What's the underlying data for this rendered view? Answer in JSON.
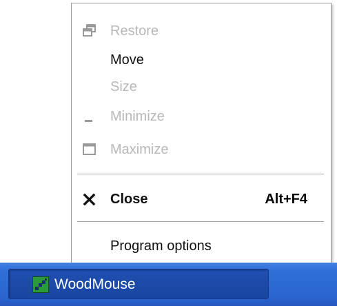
{
  "menu": {
    "items": [
      {
        "label": "Restore",
        "enabled": false,
        "icon": "restore-icon"
      },
      {
        "label": "Move",
        "enabled": true,
        "icon": ""
      },
      {
        "label": "Size",
        "enabled": false,
        "icon": ""
      },
      {
        "label": "Minimize",
        "enabled": false,
        "icon": "minimize-icon"
      },
      {
        "label": "Maximize",
        "enabled": false,
        "icon": "maximize-icon"
      },
      {
        "label": "Close",
        "enabled": true,
        "bold": true,
        "icon": "close-icon",
        "shortcut": "Alt+F4"
      },
      {
        "label": "Program options",
        "enabled": true,
        "icon": ""
      }
    ]
  },
  "taskbar": {
    "button_label": "WoodMouse",
    "app_icon": "woodmouse-app-icon"
  },
  "colors": {
    "taskbar_blue": "#2a64cf",
    "task_button_blue": "#1c4aa8",
    "disabled_text": "#b8b8b8",
    "enabled_text": "#111111",
    "app_icon_green": "#2a9a3a"
  }
}
